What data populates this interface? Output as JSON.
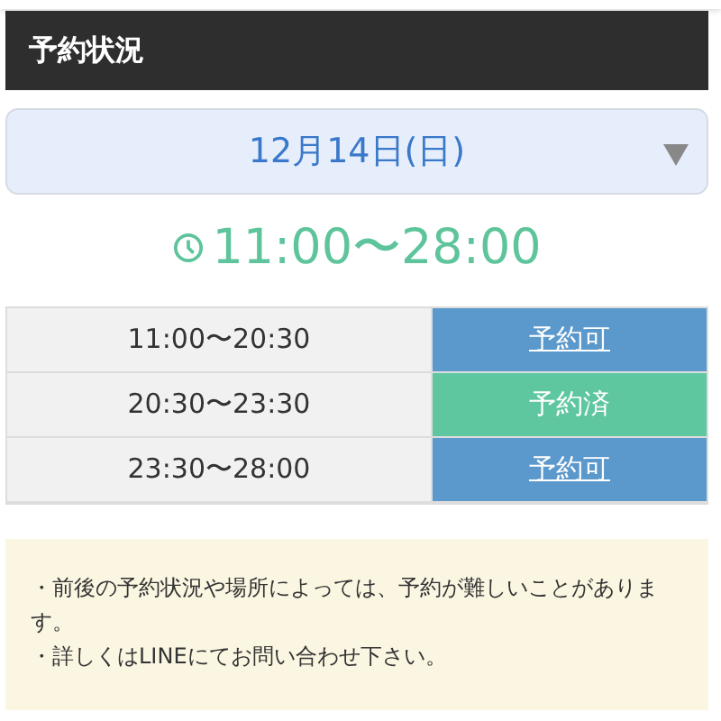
{
  "header": {
    "title": "予約状況"
  },
  "date_select": {
    "value": "12月14日(日)"
  },
  "hours": "11:00〜28:00",
  "slots": [
    {
      "time": "11:00〜20:30",
      "status": "予約可",
      "kind": "available"
    },
    {
      "time": "20:30〜23:30",
      "status": "予約済",
      "kind": "booked"
    },
    {
      "time": "23:30〜28:00",
      "status": "予約可",
      "kind": "available"
    }
  ],
  "notes": [
    "・前後の予約状況や場所によっては、予約が難しいことがあります。",
    "・詳しくはLINEにてお問い合わせ下さい。"
  ]
}
